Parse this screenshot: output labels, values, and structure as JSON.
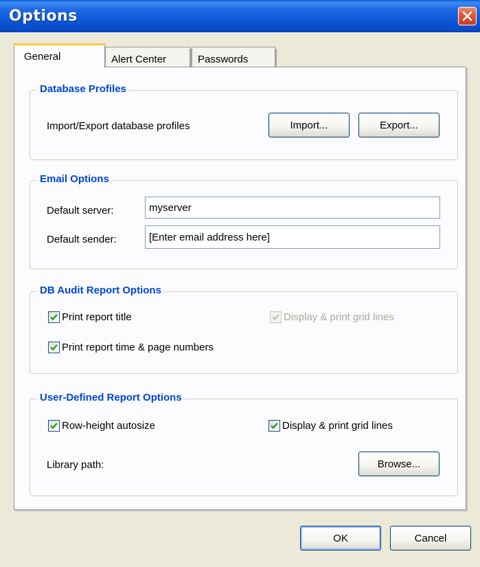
{
  "window": {
    "title": "Options"
  },
  "tabs": [
    {
      "label": "General",
      "active": true
    },
    {
      "label": "Alert Center",
      "active": false
    },
    {
      "label": "Passwords",
      "active": false
    }
  ],
  "database_profiles": {
    "title": "Database Profiles",
    "description": "Import/Export database profiles",
    "import_label": "Import...",
    "export_label": "Export..."
  },
  "email_options": {
    "title": "Email Options",
    "server_label": "Default server:",
    "server_value": "myserver",
    "sender_label": "Default sender:",
    "sender_value": "[Enter email address here]"
  },
  "db_audit": {
    "title": "DB Audit Report Options",
    "print_title": {
      "label": "Print report title",
      "checked": true,
      "enabled": true
    },
    "grid_lines": {
      "label": "Display & print grid lines",
      "checked": true,
      "enabled": false
    },
    "time_pages": {
      "label": "Print report time & page numbers",
      "checked": true,
      "enabled": true
    }
  },
  "user_defined": {
    "title": "User-Defined Report Options",
    "row_autosize": {
      "label": "Row-height autosize",
      "checked": true
    },
    "grid_lines": {
      "label": "Display & print grid lines",
      "checked": true
    },
    "library_label": "Library path:",
    "browse_label": "Browse..."
  },
  "footer": {
    "ok_label": "OK",
    "cancel_label": "Cancel"
  },
  "colors": {
    "title_bar": "#0b55d4",
    "group_title": "#0046d5",
    "dialog_bg": "#ece9d8",
    "check": "#21a121"
  },
  "icons": {
    "close": "close-icon",
    "check": "checkmark-icon"
  }
}
